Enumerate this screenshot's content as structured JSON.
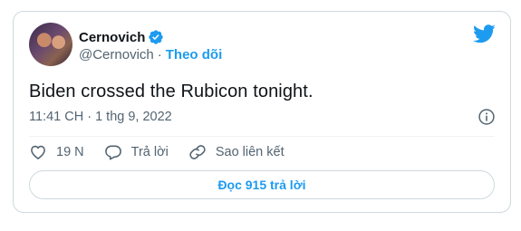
{
  "author": {
    "display_name": "Cernovich",
    "handle": "@Cernovich",
    "separator": "·",
    "follow_label": "Theo dõi"
  },
  "tweet": {
    "text": "Biden crossed the Rubicon tonight.",
    "timestamp": "11:41 CH · 1 thg 9, 2022"
  },
  "actions": {
    "like_count": "19 N",
    "reply_label": "Trả lời",
    "copy_link_label": "Sao liên kết"
  },
  "read_replies_label": "Đọc 915 trả lời",
  "icons": {
    "verified": "verified-badge-icon",
    "logo": "twitter-bird-icon",
    "info": "info-icon",
    "like": "heart-icon",
    "reply": "speech-bubble-icon",
    "link": "link-icon"
  },
  "colors": {
    "accent": "#1d9bf0",
    "text_primary": "#0f1419",
    "text_secondary": "#536471",
    "border": "#cfd9de"
  }
}
